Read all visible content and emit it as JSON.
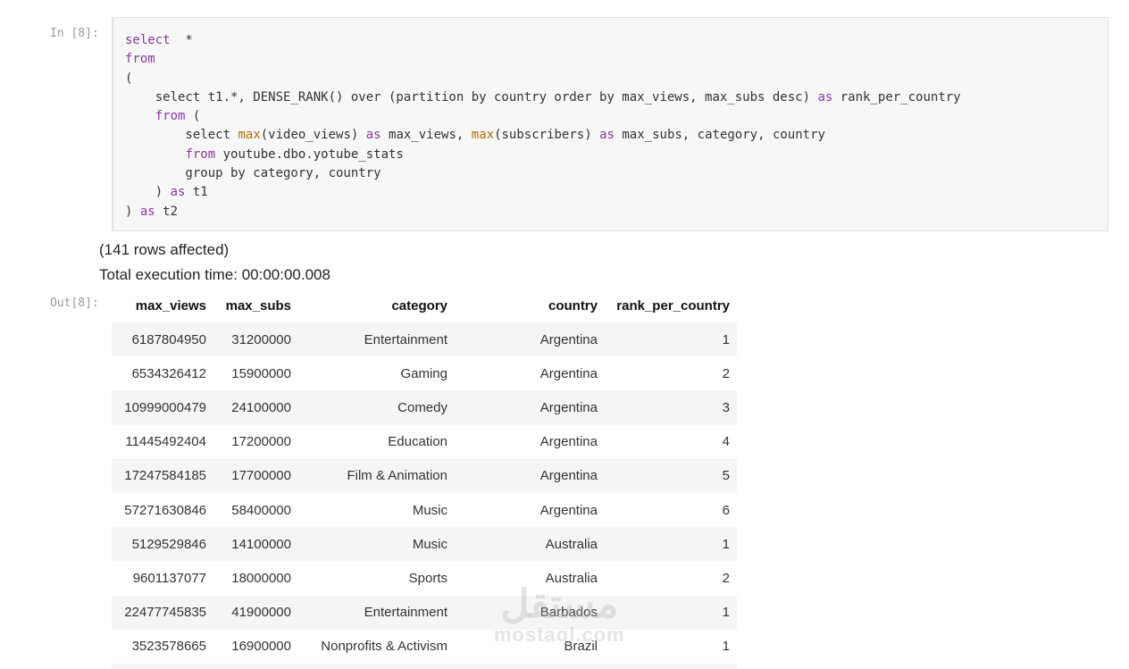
{
  "input_prompt": "In [8]:",
  "output_prompt": "Out[8]:",
  "code": {
    "l1_kw": "select",
    "l1_rest": "  *",
    "l2_kw": "from",
    "l3": "(",
    "l4_pre": "    select t1.*, DENSE_RANK() over (partition by country order by max_views, max_subs desc) ",
    "l4_as": "as",
    "l4_post": " rank_per_country",
    "l5_kw": "from",
    "l5_post": " (",
    "l6_pre": "        select ",
    "l6_fn1": "max",
    "l6_mid1": "(video_views) ",
    "l6_as1": "as",
    "l6_mid2": " max_views, ",
    "l6_fn2": "max",
    "l6_mid3": "(subscribers) ",
    "l6_as2": "as",
    "l6_post": " max_subs, category, country",
    "l7_kw": "from",
    "l7_post": " youtube.dbo.yotube_stats",
    "l8": "        group by category, country",
    "l9_pre": "    ) ",
    "l9_as": "as",
    "l9_post": " t1",
    "l10_pre": ") ",
    "l10_as": "as",
    "l10_post": " t2"
  },
  "messages": {
    "rows_affected": "(141 rows affected)",
    "execution_time": "Total execution time: 00:00:00.008"
  },
  "table": {
    "headers": [
      "max_views",
      "max_subs",
      "category",
      "country",
      "rank_per_country"
    ],
    "rows": [
      [
        "6187804950",
        "31200000",
        "Entertainment",
        "Argentina",
        "1"
      ],
      [
        "6534326412",
        "15900000",
        "Gaming",
        "Argentina",
        "2"
      ],
      [
        "10999000479",
        "24100000",
        "Comedy",
        "Argentina",
        "3"
      ],
      [
        "11445492404",
        "17200000",
        "Education",
        "Argentina",
        "4"
      ],
      [
        "17247584185",
        "17700000",
        "Film & Animation",
        "Argentina",
        "5"
      ],
      [
        "57271630846",
        "58400000",
        "Music",
        "Argentina",
        "6"
      ],
      [
        "5129529846",
        "14100000",
        "Music",
        "Australia",
        "1"
      ],
      [
        "9601137077",
        "18000000",
        "Sports",
        "Australia",
        "2"
      ],
      [
        "22477745835",
        "41900000",
        "Entertainment",
        "Barbados",
        "1"
      ],
      [
        "3523578665",
        "16900000",
        "Nonprofits & Activism",
        "Brazil",
        "1"
      ],
      [
        "",
        "",
        "",
        "",
        ""
      ]
    ]
  },
  "watermark": {
    "arabic": "مستقل",
    "latin": "mostaql.com"
  },
  "colors": {
    "keyword": "#8a3aa3",
    "function": "#b26d00",
    "code_bg": "#f7f7f7",
    "row_stripe": "#f5f5f5"
  }
}
